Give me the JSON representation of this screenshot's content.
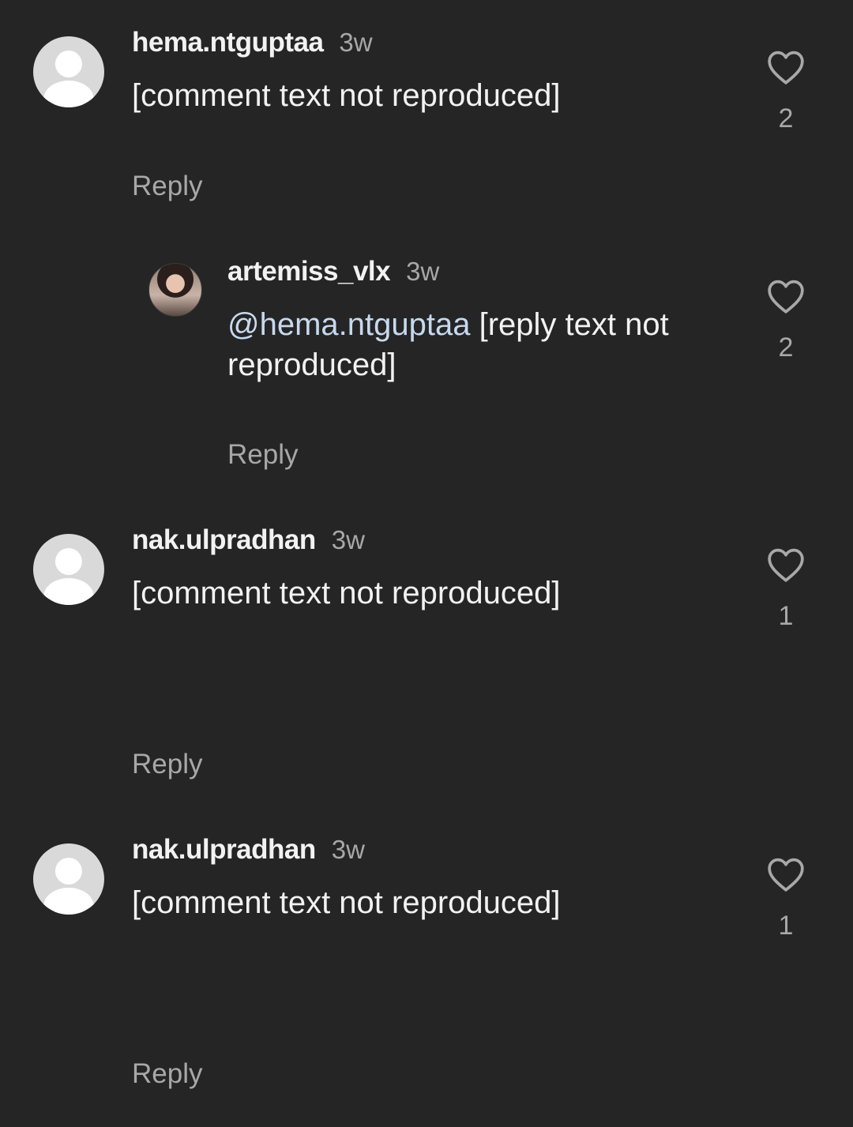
{
  "comments": [
    {
      "username": "hema.ntguptaa",
      "time": "3w",
      "mention": "",
      "text": "[comment text not reproduced]",
      "reply_label": "Reply",
      "likes": "2"
    },
    {
      "username": "artemiss_vlx",
      "time": "3w",
      "mention": "@hema.ntguptaa",
      "text": " [reply text not reproduced]",
      "reply_label": "Reply",
      "likes": "2"
    },
    {
      "username": "nak.ulpradhan",
      "time": "3w",
      "mention": "",
      "text": "[comment text not reproduced]",
      "reply_label": "Reply",
      "likes": "1"
    },
    {
      "username": "nak.ulpradhan",
      "time": "3w",
      "mention": "",
      "text": "[comment text not reproduced]",
      "reply_label": "Reply",
      "likes": "1"
    }
  ]
}
